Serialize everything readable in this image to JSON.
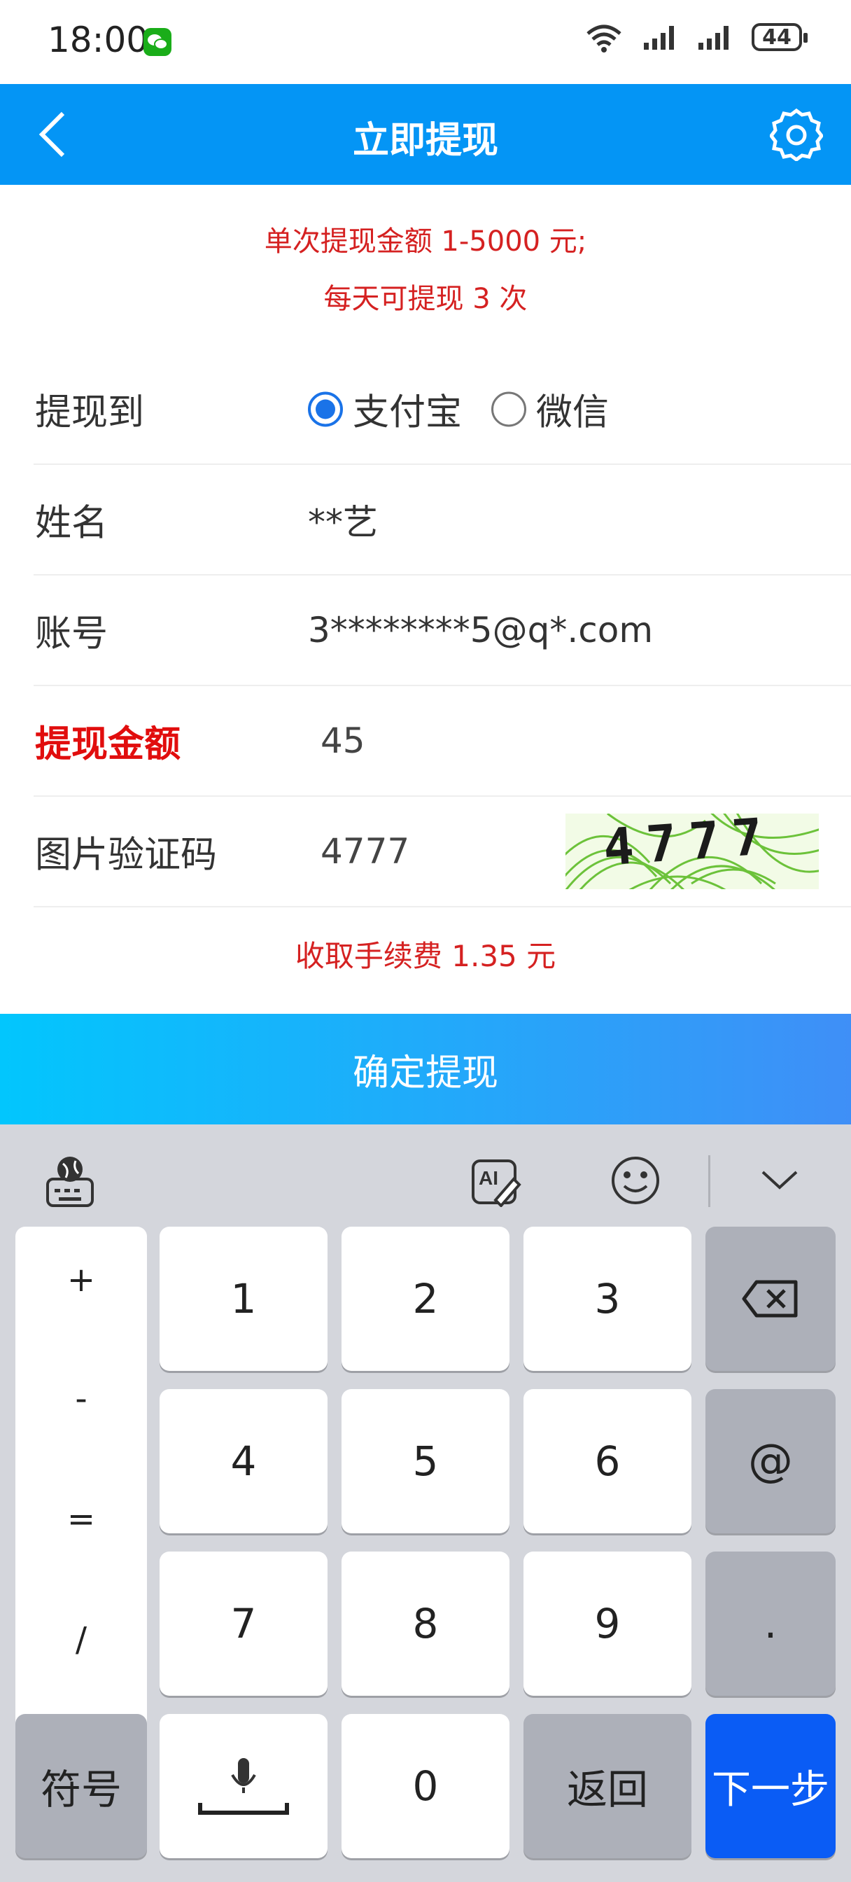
{
  "status_bar": {
    "time": "18:00",
    "battery": "44"
  },
  "header": {
    "title": "立即提现"
  },
  "notices": {
    "line1": "单次提现金额 1-5000 元;",
    "line2": "每天可提现 3 次"
  },
  "form": {
    "withdraw_to": {
      "label": "提现到",
      "options": [
        {
          "label": "支付宝",
          "selected": true
        },
        {
          "label": "微信",
          "selected": false
        }
      ]
    },
    "name": {
      "label": "姓名",
      "value": "**艺"
    },
    "account": {
      "label": "账号",
      "value": "3********5@q*.com"
    },
    "amount": {
      "label": "提现金额",
      "value": "45"
    },
    "captcha": {
      "label": "图片验证码",
      "value": "4777",
      "image_text": "4777"
    }
  },
  "fee": "收取手续费 1.35 元",
  "confirm_button": "确定提现",
  "keyboard": {
    "symbols": [
      "+",
      "-",
      "=",
      "/"
    ],
    "digits": [
      "1",
      "2",
      "3",
      "4",
      "5",
      "6",
      "7",
      "8",
      "9",
      "0"
    ],
    "at": "@",
    "dot": ".",
    "symbols_key": "符号",
    "back_key": "返回",
    "next_key": "下一步"
  },
  "colors": {
    "header": "#0495f5",
    "notice_red": "#d52121",
    "label_red": "#e10d0d",
    "next_key": "#0a5cf5"
  }
}
